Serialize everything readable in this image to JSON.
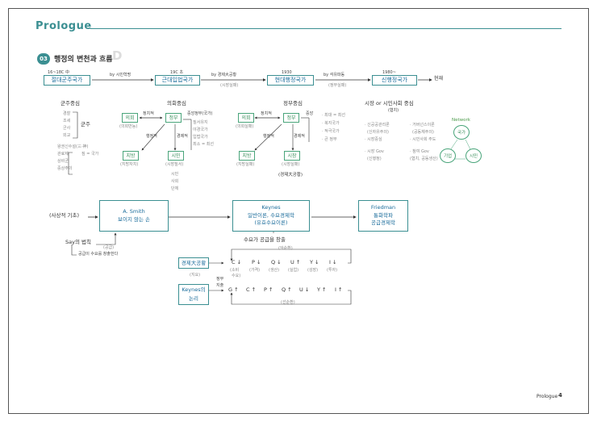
{
  "header": {
    "title": "Prologue"
  },
  "section": {
    "number": "03",
    "title": "행정의 변천과 흐름",
    "deco_letter": "D"
  },
  "timeline": {
    "era1_label": "16~18C 中",
    "era1_box": "절대군주국가",
    "arrow1": "by 시민혁명",
    "era2_label": "19C 초",
    "era2_box": "근대입법국가",
    "arrow2": "by 경제大공황",
    "arrow2_sub": "(시장실패)",
    "era3_label": "1930",
    "era3_box": "현대행정국가",
    "arrow3": "by 석유파동",
    "arrow3_sub": "(정부실패)",
    "era4_label": "1980~",
    "era4_box": "신행정국가",
    "present": "현재"
  },
  "col1": {
    "heading": "군주중심",
    "items": [
      "경찰",
      "조세",
      "군사",
      "외교"
    ],
    "items_label": "군주",
    "extras": [
      "왕권신수설(三·神)",
      "관료제",
      "짐 = 국가",
      "상비군",
      "중상주의"
    ]
  },
  "col2": {
    "heading": "의회중심",
    "uihoe": "의회",
    "uihoe_sub": "(의회만능)",
    "jeongchijeok": "정치적",
    "jeongbu": "정부",
    "haengjeongjeok": "행정적",
    "gyeongjejeok": "경제적",
    "jibang": "지방",
    "jibang_sub": "(지방자치)",
    "simin": "시민",
    "simin_sub": "(시장질서)",
    "simin_items": [
      "시민",
      "사회",
      "단체"
    ],
    "center_title": "중앙정부(국가)",
    "center_items": [
      "· 질서유지",
      "· 야경국가",
      "· 입법국가",
      "· 최소 = 최선"
    ]
  },
  "col3": {
    "heading": "정부중심",
    "uihoe": "의회",
    "uihoe_sub": "(의회실패)",
    "jeongchijeok": "정치적",
    "jeongbu": "정부",
    "haengjeongjeok": "행정적",
    "gyeongjejeok": "경제적",
    "jibang": "지방",
    "jibang_sub": "(지방실패)",
    "sijang": "시장",
    "sijang_sub": "(시장실패)",
    "sijang_note": "(경제大공황)",
    "center_title": "중앙",
    "center_items": [
      "· 최대 = 최선",
      "· 복지국가",
      "· 적극국가",
      "· 큰 정부"
    ]
  },
  "col4": {
    "heading": "시장 or 시민사회 중심",
    "heading_sub": "(협치)",
    "left_items": [
      "· 신공공관리론",
      "(신자유주의)",
      "· 시장중심"
    ],
    "left_gov": "· 시장 Gov",
    "left_gov_sub": "(신행정)",
    "right_items": [
      "· 거버넌스이론",
      "(공동체주의)",
      "· 시민사회 주도"
    ],
    "right_gov": "· 참여 Gov",
    "right_gov_sub": "(협치, 공동생산)",
    "network_title": "Network",
    "net_state": "국가",
    "net_firm": "기업",
    "net_citizen": "시민"
  },
  "theories": {
    "left_label": "(사상적 기초)",
    "smith_line1": "A. Smith",
    "smith_line2": "보이지 않는 손",
    "keynes_line1": "Keynes",
    "keynes_line2": "일반이론, 수요경제학",
    "keynes_line3": "(유효수요이론)",
    "friedman_line1": "Friedman",
    "friedman_line2": "통화학파",
    "friedman_line3": "공급경제학"
  },
  "say": {
    "title": "Say의 법칙",
    "sub": "(공급)",
    "desc": "공급이 수요를 창출한다"
  },
  "depression": {
    "caption": "수요가 공급을 창출",
    "caption_sub": "(악순환)",
    "box1": "경제大공황",
    "box1_sub": "(지요)",
    "chain1": [
      "C ↓",
      "P ↓",
      "Q ↓",
      "U ↑",
      "Y ↓",
      "I ↓"
    ],
    "chain1_sub": [
      "(소비",
      "(가격)",
      "(생산)",
      "(실업)",
      "(성장)",
      "(투자)"
    ],
    "chain1_sub2": "수요)",
    "box2_line1": "Keynes의",
    "box2_line2": "논리",
    "gov_spend": [
      "정부",
      "지출"
    ],
    "chain2": [
      "G ↑",
      "C ↑",
      "P ↑",
      "Q ↑",
      "U ↓",
      "Y ↑",
      "I ↑"
    ],
    "chain2_sub": "(선순환)"
  },
  "footer": {
    "label": "Prologue",
    "page": "4"
  }
}
